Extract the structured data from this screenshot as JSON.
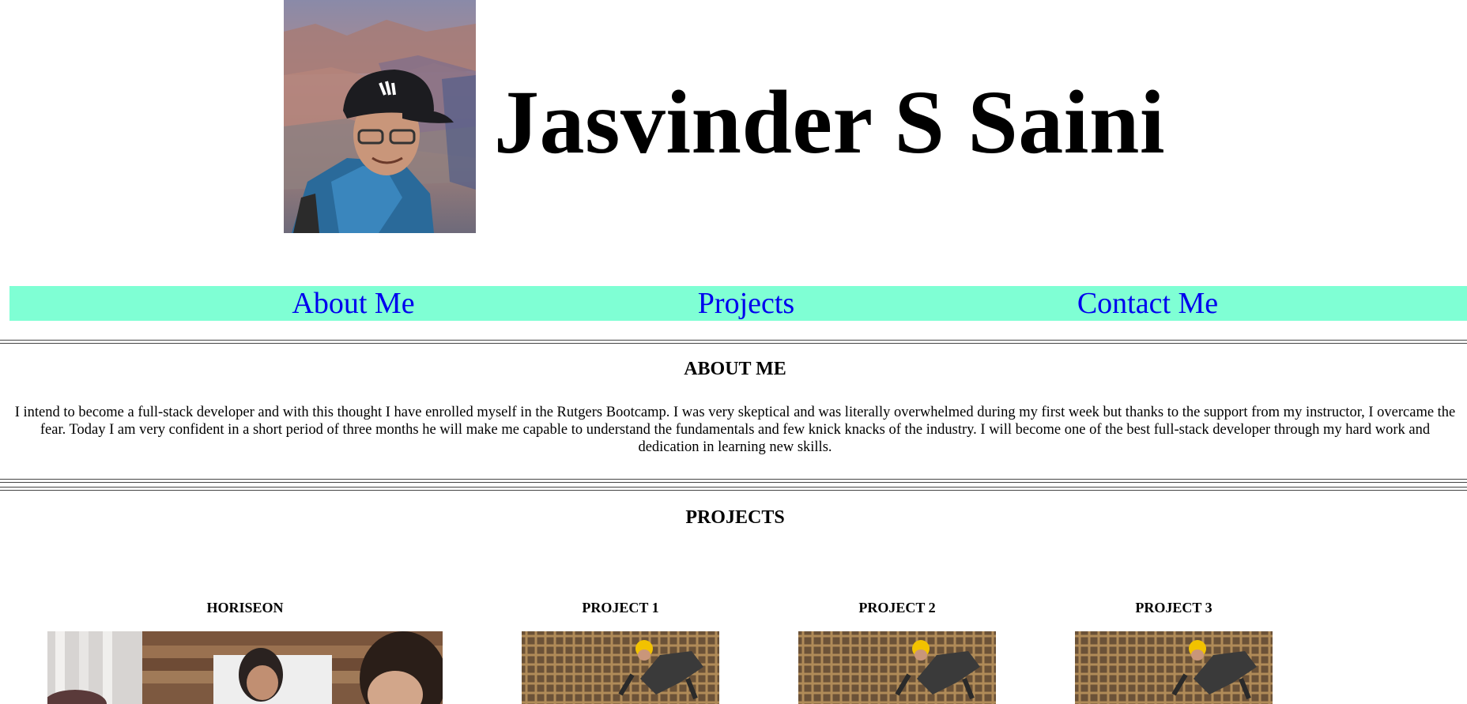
{
  "header": {
    "name": "Jasvinder S Saini",
    "photo_icon": "profile-photo"
  },
  "nav": {
    "items": [
      {
        "label": "About Me"
      },
      {
        "label": "Projects"
      },
      {
        "label": "Contact Me"
      }
    ],
    "background": "#7fffd4",
    "link_color": "#0000ee"
  },
  "about": {
    "heading": "ABOUT ME",
    "text": "I intend to become a full-stack developer and with this thought I have enrolled myself in the Rutgers Bootcamp. I was very skeptical and was literally overwhelmed during my first week but thanks to the support from my instructor, I overcame the fear. Today I am very confident in a short period of three months he will make me capable to understand the fundamentals and few knick knacks of the industry. I will become one of the best full-stack developer through my hard work and dedication in learning new skills."
  },
  "projects": {
    "heading": "PROJECTS",
    "items": [
      {
        "title": "HORISEON",
        "image_icon": "team-meeting-image"
      },
      {
        "title": "PROJECT 1",
        "image_icon": "construction-worker-image"
      },
      {
        "title": "PROJECT 2",
        "image_icon": "construction-worker-image"
      },
      {
        "title": "PROJECT 3",
        "image_icon": "construction-worker-image"
      }
    ]
  }
}
